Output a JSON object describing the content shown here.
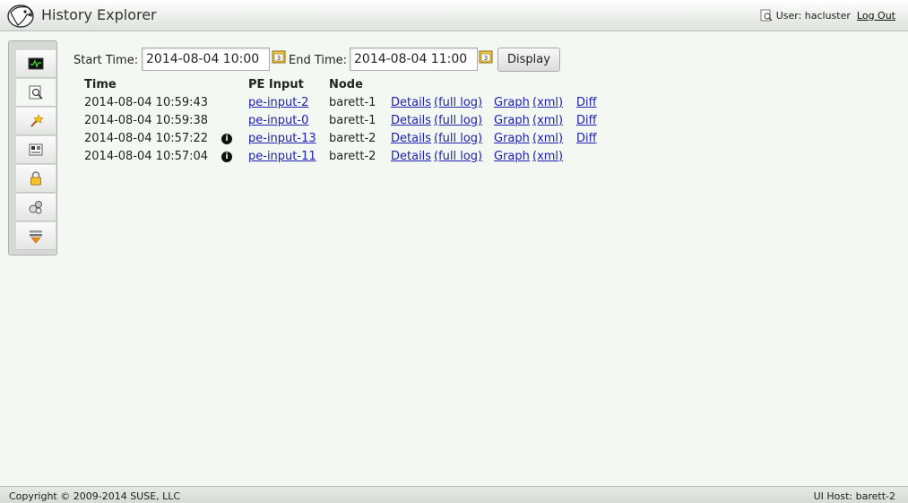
{
  "header": {
    "title": "History Explorer",
    "user_label": "User: hacluster",
    "logout_label": "Log Out"
  },
  "sidebar": {
    "items": [
      {
        "icon": "dashboard-icon"
      },
      {
        "icon": "history-explorer-icon"
      },
      {
        "icon": "setup-wizard-icon"
      },
      {
        "icon": "cluster-configuration-icon"
      },
      {
        "icon": "access-control-icon"
      },
      {
        "icon": "resources-icon"
      },
      {
        "icon": "filter-icon"
      }
    ],
    "active_index": 1
  },
  "filters": {
    "start_label": "Start Time:",
    "start_value": "2014-08-04 10:00",
    "end_label": "End Time:",
    "end_value": "2014-08-04 11:00",
    "display_label": "Display"
  },
  "table": {
    "headers": {
      "time": "Time",
      "pe_input": "PE Input",
      "node": "Node"
    },
    "rows": [
      {
        "time": "2014-08-04 10:59:43",
        "info": false,
        "pe_input": "pe-input-2",
        "node": "barett-1",
        "details": "Details",
        "full_log": "(full log)",
        "graph": "Graph",
        "xml": "(xml)",
        "diff": "Diff"
      },
      {
        "time": "2014-08-04 10:59:38",
        "info": false,
        "pe_input": "pe-input-0",
        "node": "barett-1",
        "details": "Details",
        "full_log": "(full log)",
        "graph": "Graph",
        "xml": "(xml)",
        "diff": "Diff"
      },
      {
        "time": "2014-08-04 10:57:22",
        "info": true,
        "pe_input": "pe-input-13",
        "node": "barett-2",
        "details": "Details",
        "full_log": "(full log)",
        "graph": "Graph",
        "xml": "(xml)",
        "diff": "Diff"
      },
      {
        "time": "2014-08-04 10:57:04",
        "info": true,
        "pe_input": "pe-input-11",
        "node": "barett-2",
        "details": "Details",
        "full_log": "(full log)",
        "graph": "Graph",
        "xml": "(xml)",
        "diff": ""
      }
    ]
  },
  "footer": {
    "copyright": "Copyright © 2009-2014 SUSE, LLC",
    "ui_host": "UI Host: barett-2"
  },
  "colors": {
    "link": "#2020b0",
    "background": "#f3f8f3"
  }
}
